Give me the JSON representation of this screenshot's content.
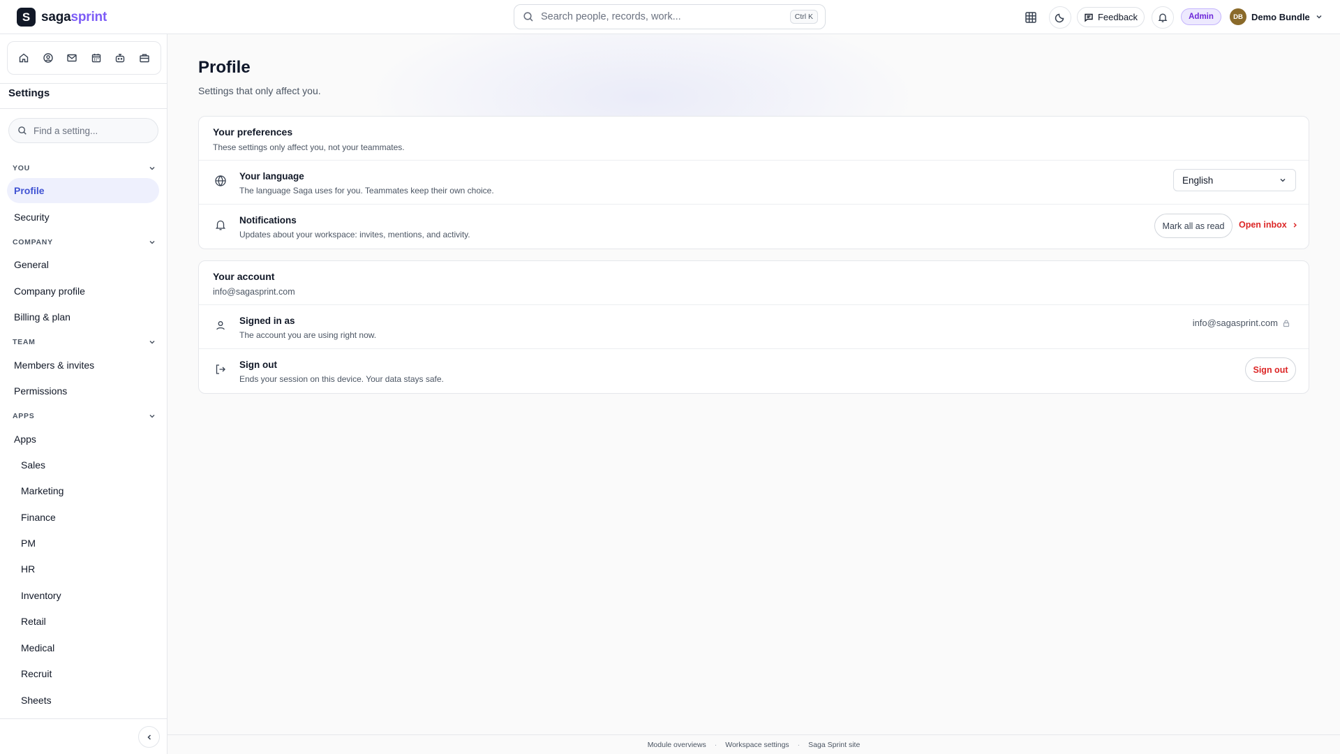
{
  "brand": {
    "name_part1": "saga",
    "name_part2": "sprint",
    "mark": "S",
    "accent_color": "#7c5cf6"
  },
  "topbar": {
    "search_placeholder": "Search people, records, work...",
    "search_shortcut": "Ctrl K",
    "feedback_label": "Feedback",
    "role_badge": "Admin",
    "user_initials": "DB",
    "user_name": "Demo Bundle"
  },
  "sidebar": {
    "title": "Settings",
    "find_placeholder": "Find a setting...",
    "sections": {
      "you": "YOU",
      "company": "COMPANY",
      "team": "TEAM",
      "apps": "APPS"
    },
    "items": {
      "profile": "Profile",
      "security": "Security",
      "general": "General",
      "company_profile": "Company profile",
      "billing": "Billing & plan",
      "members": "Members & invites",
      "permissions": "Permissions",
      "apps": "Apps",
      "sales": "Sales",
      "marketing": "Marketing",
      "finance": "Finance",
      "pm": "PM",
      "hr": "HR",
      "inventory": "Inventory",
      "retail": "Retail",
      "medical": "Medical",
      "recruit": "Recruit",
      "sheets": "Sheets"
    },
    "active_color": "#4053d3"
  },
  "page": {
    "title": "Profile",
    "subtitle": "Settings that only affect you."
  },
  "preferences": {
    "title": "Your preferences",
    "description": "These settings only affect you, not your teammates.",
    "language": {
      "title": "Your language",
      "description": "The language Saga uses for you. Teammates keep their own choice.",
      "value": "English"
    },
    "notifications": {
      "title": "Notifications",
      "description": "Updates about your workspace: invites, mentions, and activity.",
      "mark_read_label": "Mark all as read",
      "open_inbox_label": "Open inbox"
    }
  },
  "account": {
    "title": "Your account",
    "email": "info@sagasprint.com",
    "signed_in": {
      "title": "Signed in as",
      "description": "The account you are using right now.",
      "value": "info@sagasprint.com"
    },
    "sign_out": {
      "title": "Sign out",
      "description": "Ends your session on this device. Your data stays safe.",
      "button_label": "Sign out"
    },
    "danger_color": "#dc2626"
  },
  "footer": {
    "links": [
      "Module overviews",
      "Workspace settings",
      "Saga Sprint site"
    ]
  }
}
